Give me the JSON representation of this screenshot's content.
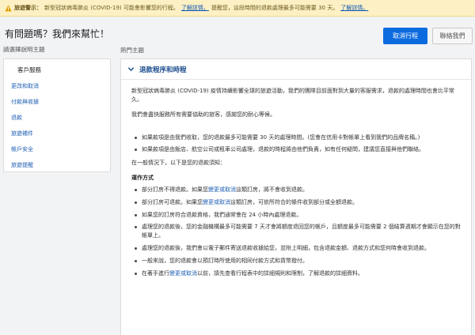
{
  "alert": {
    "label": "旅遊警示：",
    "text": "新型冠狀病毒肺炎 (COVID-19) 可能會影響您的行程。",
    "link1": "了解詳情。",
    "text2": "提醒您，這段時間的退款處理最多可能需要 30 天。",
    "link2": "了解詳情。"
  },
  "header": {
    "title": "有問題嗎？我們來幫忙！",
    "cancel_button": "取消行程",
    "contact_button": "聯絡我們"
  },
  "sidebar": {
    "heading": "請選擇說明主題",
    "group_title": "客戶服務",
    "items": [
      "更改和取消",
      "付款與收據",
      "退款",
      "旅遊補件",
      "帳戶安全",
      "旅遊提醒"
    ]
  },
  "main": {
    "heading": "熱門主題",
    "panel_title": "退款程序和時程",
    "intro1": "新型冠狀病毒肺炎 (COVID-19) 疫情持續影響全球的旅遊活動，我們的團隊目前面對到大量的客服需求，退款的處理時間也會比平常久。",
    "intro2": "我們會盡快服務所有需要協助的旅客，感謝您的耐心等候。",
    "bullets1": [
      "如果款項是由我們收取，您的退款最多可能需要 30 天的處理時間。(您會在信用卡對帳單上看到我們的品牌名稱。)",
      "如果款項是由飯店、航空公司或租車公司處理，退款的時程將由他們負責，如有任何疑問，建議您直接與他們聯絡。"
    ],
    "general": "在一般情況下，以下是您的退款須知：",
    "sub_title": "運作方式",
    "bullet_a_pre": "部分訂房不得退款。如果您",
    "bullet_a_link": "變更或取消",
    "bullet_a_post": "這類訂房，將不會收到退款。",
    "bullet_b_pre": "部分訂房可退款。如果您",
    "bullet_b_link": "變更或取消",
    "bullet_b_post": "這類訂房，可依所符合的條件收到部分或全額退款。",
    "bullet_c": "如果您的訂房符合退款資格，我們通常會在 24 小時內處理退款。",
    "bullet_d": "處理您的退款後，您的金融機構最多可能需要 7 天才會將額度退回您的帳戶，且額度最多可能需要 2 個結算週期才會顯示在您的對帳單上。",
    "bullet_e": "處理您的退款後，我們會以電子郵件寄送退款收據給您，並附上明細，包含退款金額、退款方式和您何時會收到退款。",
    "bullet_f": "一般來說，您的退款會以預訂時所使用的相同付款方式和貨幣撥付。",
    "bullet_g_pre": "在著手進行",
    "bullet_g_link": "變更或取消",
    "bullet_g_post": "以前，請先查看行程表中的詳細規則和限制，了解退款的詳細資料。"
  },
  "colors": {
    "primary": "#0d6be0",
    "link": "#1f5fb3",
    "alert_bg": "#fdf0c4",
    "panel_title": "#1d4e8f"
  },
  "icons": {
    "alert": "warning-icon",
    "panel": "chevron-down-icon"
  }
}
